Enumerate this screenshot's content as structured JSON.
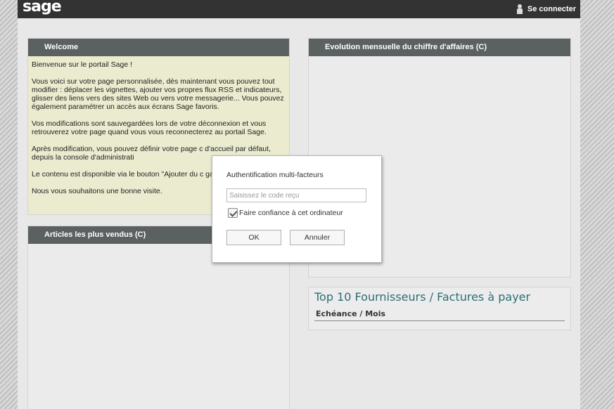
{
  "header": {
    "logo": "sage",
    "login_label": "Se connecter",
    "login_icon": "user-icon"
  },
  "welcome": {
    "title": "Welcome",
    "paragraphs": [
      "Bienvenue sur le portail Sage !",
      "Vous voici sur votre page personnalisée, dès maintenant vous pouvez tout modifier : déplacer les vignettes, ajouter vos propres flux RSS et indicateurs, glisser des liens vers des sites Web ou vers votre messagerie... Vous pouvez également paramétrer un accès aux écrans Sage favoris.",
      "Vos modifications sont sauvegardées lors de votre déconnexion et vous retrouverez votre page quand vous vous reconnecterez au portail Sage.",
      "Après modification, vous pouvez définir votre page c d'accueil par défaut, depuis la console d'administrati",
      "Le contenu est disponible via le bouton \"Ajouter du c gauche de l'interface",
      "Nous vous souhaitons une bonne visite."
    ]
  },
  "articles": {
    "title": "Articles les plus vendus (C)"
  },
  "evolution": {
    "title": "Evolution mensuelle du chiffre d'affaires (C)"
  },
  "top10": {
    "title": "Top 10 Fournisseurs / Factures à payer",
    "column": "Echéance / Mois"
  },
  "mfa_dialog": {
    "title": "Authentification multi-facteurs",
    "code_placeholder": "Saisissez le code reçu",
    "code_value": "",
    "trust_label": "Faire confiance à cet ordinateur",
    "trust_checked": true,
    "ok_label": "OK",
    "cancel_label": "Annuler"
  }
}
